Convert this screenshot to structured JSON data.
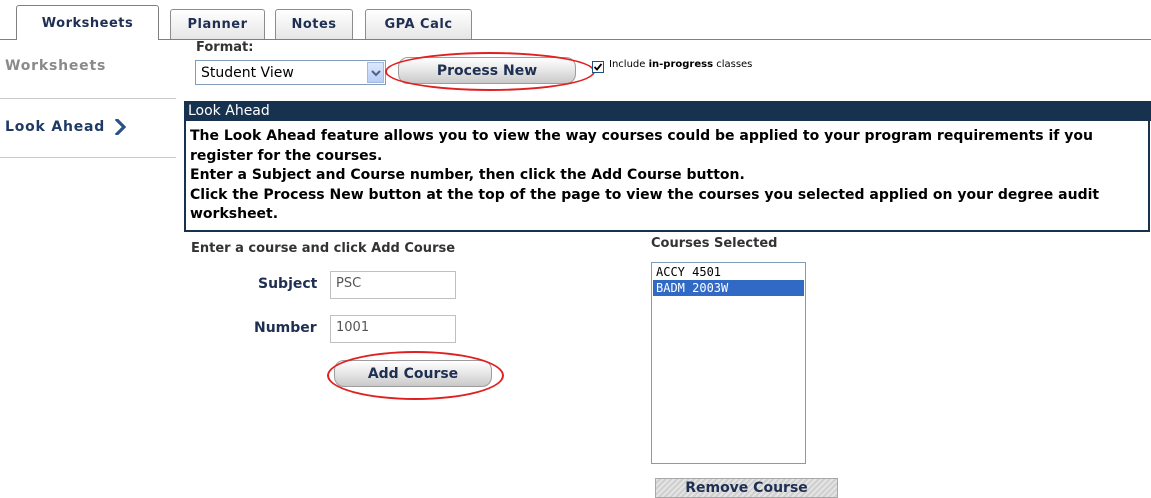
{
  "tabs": [
    {
      "label": "Worksheets",
      "active": true
    },
    {
      "label": "Planner"
    },
    {
      "label": "Notes"
    },
    {
      "label": "GPA Calc"
    }
  ],
  "sidebar": {
    "items": [
      {
        "label": "Worksheets",
        "icon": ""
      },
      {
        "label": "Look Ahead",
        "icon": "chevron-right-icon"
      }
    ]
  },
  "format": {
    "label": "Format:",
    "selected": "Student View",
    "process_button": "Process New",
    "include_prefix": "Include ",
    "include_bold": "in-progress",
    "include_suffix": " classes",
    "include_checked": true
  },
  "look_ahead": {
    "title": "Look Ahead",
    "paragraphs": [
      "The Look Ahead feature allows you to view the way courses could be applied to your program requirements if you register for the courses.",
      "Enter a Subject and Course number, then click the Add Course button.",
      "Click the Process New button at the top of the page to view the courses you selected applied on your degree audit worksheet."
    ]
  },
  "add_course": {
    "title": "Enter a course and click Add Course",
    "subject_label": "Subject",
    "subject_value": "PSC",
    "number_label": "Number",
    "number_value": "1001",
    "button": "Add Course"
  },
  "courses_selected": {
    "title": "Courses Selected",
    "items": [
      "ACCY 4501",
      "BADM 2003W"
    ],
    "selected_index": 1,
    "remove_button": "Remove Course"
  },
  "colors": {
    "header_bg": "#17324f",
    "tab_text": "#1e2f52",
    "highlight_ellipse": "#e02020",
    "list_selection": "#316ac5"
  }
}
